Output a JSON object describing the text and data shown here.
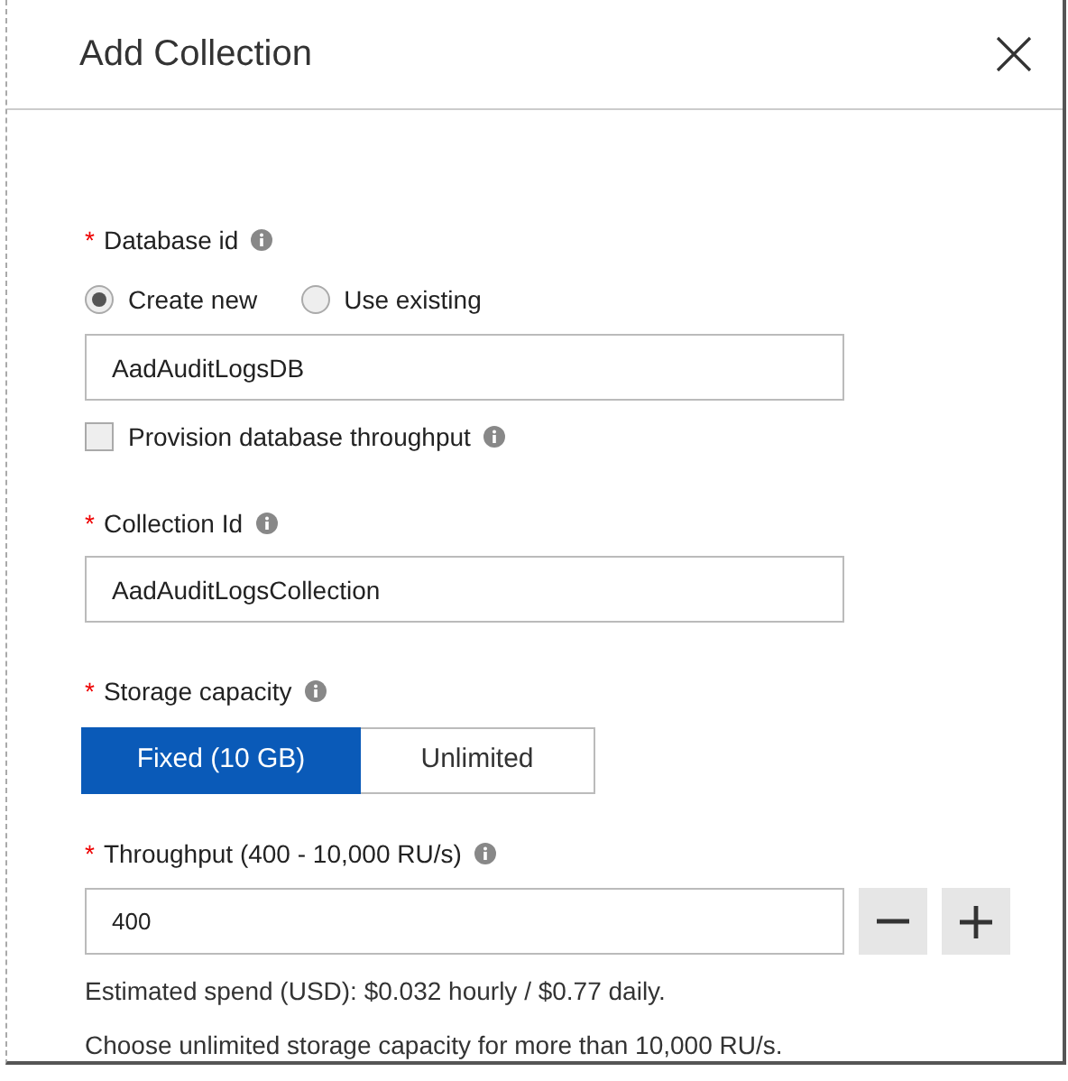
{
  "panel": {
    "title": "Add Collection"
  },
  "fields": [
    {
      "kind": "radio-text",
      "required_mark": "*",
      "label": "Database id",
      "options": [
        {
          "label": "Create new",
          "selected": true
        },
        {
          "label": "Use existing",
          "selected": false
        }
      ],
      "value": "AadAuditLogsDB",
      "checkbox": {
        "label": "Provision database throughput",
        "checked": false
      }
    },
    {
      "kind": "text",
      "required_mark": "*",
      "label": "Collection Id",
      "value": "AadAuditLogsCollection"
    },
    {
      "kind": "toggle",
      "required_mark": "*",
      "label": "Storage capacity",
      "options": [
        {
          "label": "Fixed (10 GB)",
          "selected": true
        },
        {
          "label": "Unlimited",
          "selected": false
        }
      ]
    },
    {
      "kind": "number",
      "required_mark": "*",
      "label": "Throughput (400 - 10,000 RU/s)",
      "value": "400",
      "notes": [
        "Estimated spend (USD): $0.032 hourly / $0.77 daily.",
        "Choose unlimited storage capacity for more than 10,000 RU/s."
      ]
    }
  ]
}
